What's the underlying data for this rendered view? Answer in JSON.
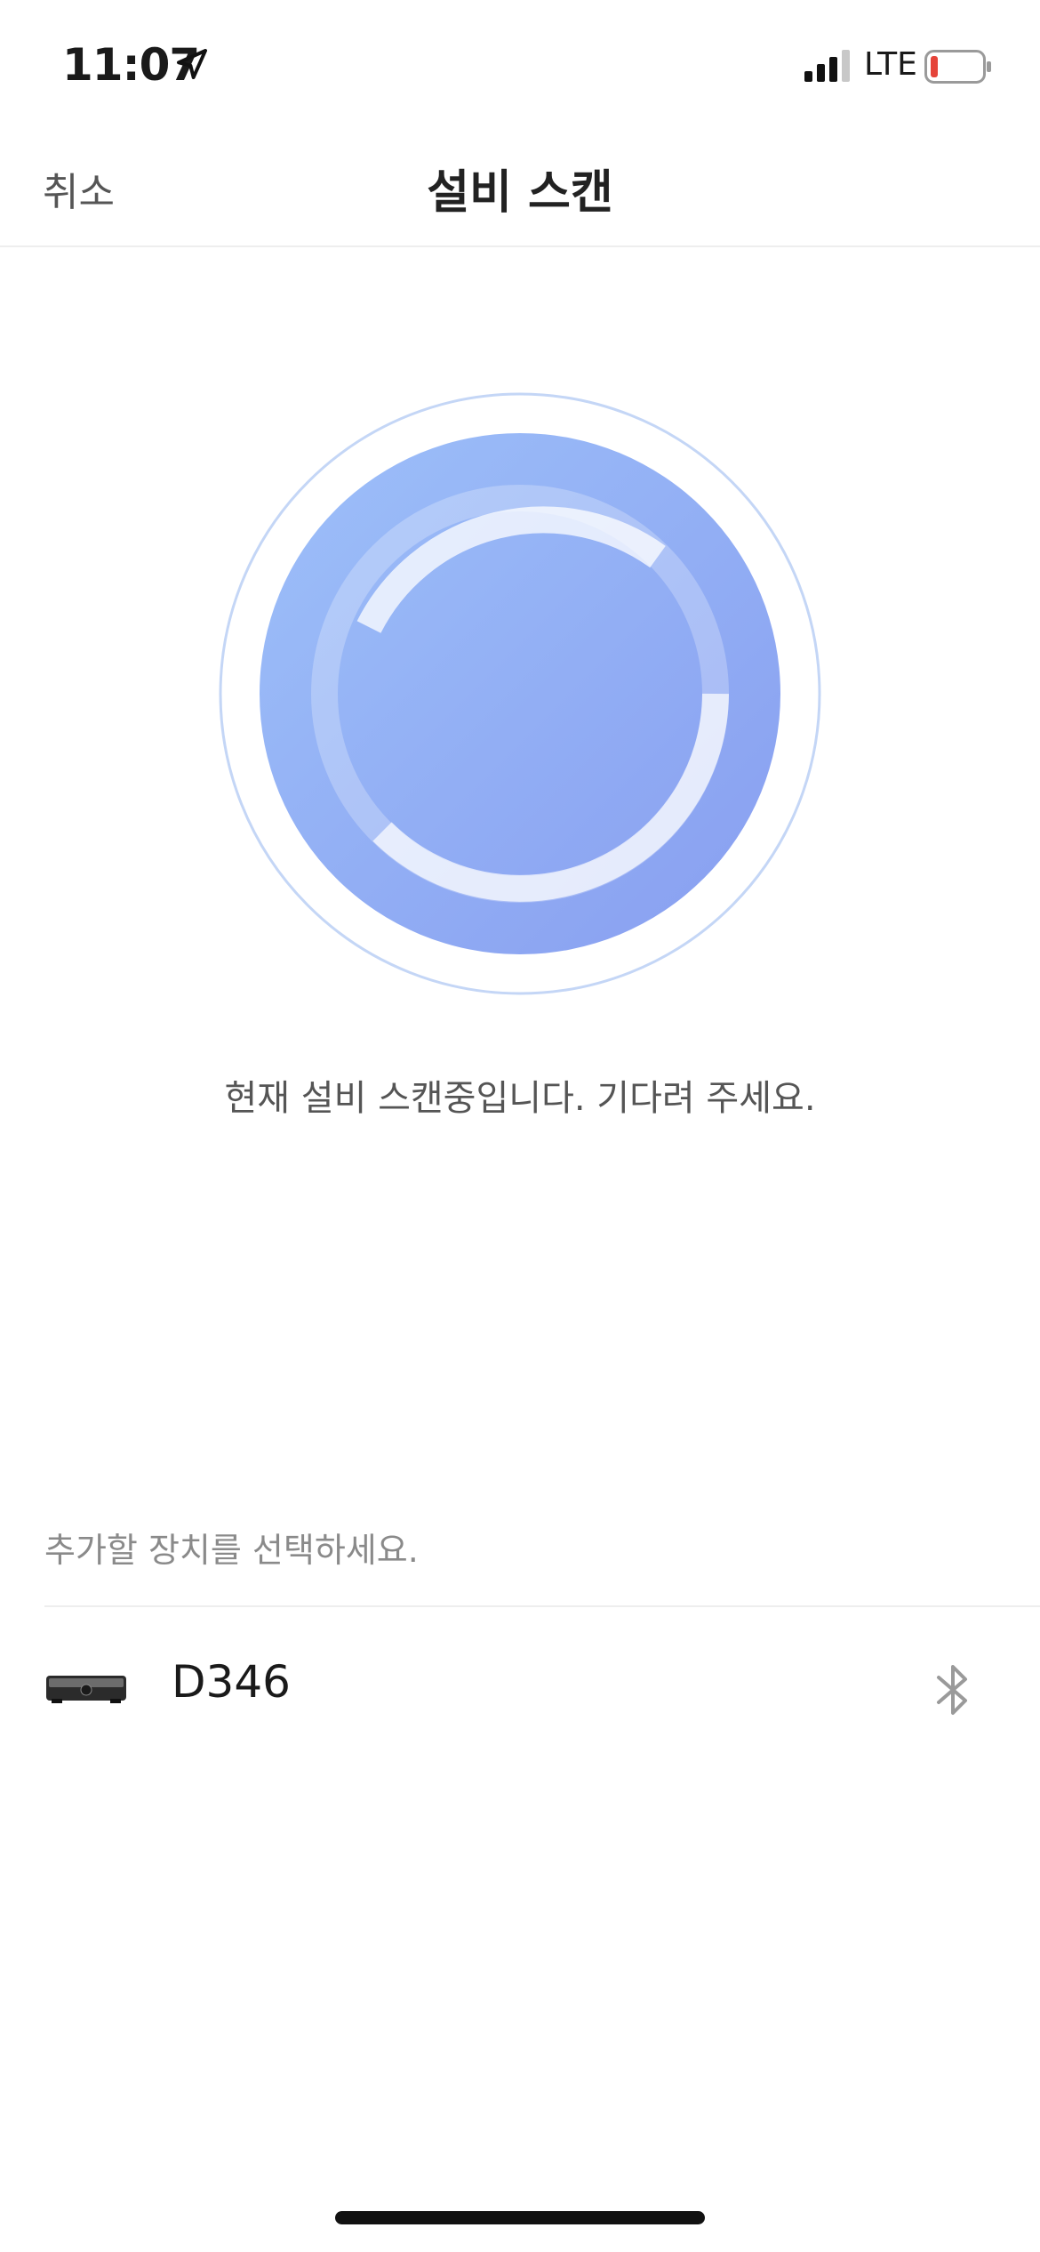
{
  "status_bar": {
    "time": "11:07",
    "network": "LTE",
    "location_icon": "location-arrow-icon",
    "signal_icon": "cellular-signal-icon",
    "battery_icon": "battery-low-icon",
    "battery_color": "#e5443a"
  },
  "nav": {
    "cancel_label": "취소",
    "title": "설비 스캔"
  },
  "scan": {
    "status_text": "현재 설비 스캔중입니다. 기다려 주세요.",
    "gradient_start": "#9dc0f9",
    "gradient_end": "#8aa0f0"
  },
  "devices": {
    "prompt": "추가할 장치를 선택하세요.",
    "items": [
      {
        "name": "D346",
        "connection_icon": "bluetooth-icon"
      }
    ]
  }
}
